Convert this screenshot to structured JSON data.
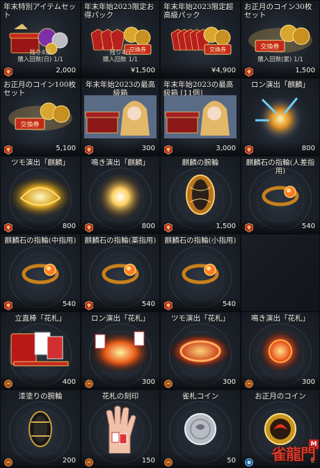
{
  "items": [
    {
      "title": "年末特別アイテムセット",
      "price": "2,000",
      "currency": "gem",
      "notes": [
        "残り4日",
        "購入回数(日) 1/1"
      ],
      "art": "set"
    },
    {
      "title": "年末年始2023限定お得パック",
      "price": "¥1,500",
      "currency": "yen",
      "notes": [
        "残り4日",
        "購入回数 1/1"
      ],
      "art": "pack"
    },
    {
      "title": "年末年始2023限定超高級パック",
      "price": "¥4,900",
      "currency": "yen",
      "notes": [],
      "art": "pack-big"
    },
    {
      "title": "お正月のコイン30枚セット",
      "price": "1,500",
      "currency": "gem",
      "notes": [
        "購入回数(累) 1/1"
      ],
      "art": "coins"
    },
    {
      "title": "お正月のコイン100枚セット",
      "price": "5,100",
      "currency": "gem",
      "notes": [],
      "art": "coins-big"
    },
    {
      "title": "年末年始2023の最高級箱",
      "price": "300",
      "currency": "gem",
      "notes": [],
      "art": "box",
      "center": true
    },
    {
      "title": "年末年始2023の最高級箱 [11個]",
      "price": "3,000",
      "currency": "gem",
      "notes": [],
      "art": "box11"
    },
    {
      "title": "ロン演出「麒麟」",
      "price": "800",
      "currency": "gem",
      "notes": [],
      "art": "blue-fx",
      "center": true
    },
    {
      "title": "ツモ演出「麒麟」",
      "price": "800",
      "currency": "gem",
      "notes": [],
      "art": "gold-fx",
      "center": true
    },
    {
      "title": "鳴き演出「麒麟」",
      "price": "800",
      "currency": "gem",
      "notes": [],
      "art": "burst",
      "center": true
    },
    {
      "title": "麒麟の腕輪",
      "price": "1,500",
      "currency": "gem",
      "notes": [],
      "art": "bracelet",
      "center": true
    },
    {
      "title": "麒麟石の指輪(人差指用)",
      "price": "540",
      "currency": "gem",
      "notes": [],
      "art": "ring",
      "center": true
    },
    {
      "title": "麒麟石の指輪(中指用)",
      "price": "540",
      "currency": "gem",
      "notes": [],
      "art": "ring",
      "center": true
    },
    {
      "title": "麒麟石の指輪(薬指用)",
      "price": "540",
      "currency": "gem",
      "notes": [],
      "art": "ring",
      "center": true
    },
    {
      "title": "麒麟石の指輪(小指用)",
      "price": "540",
      "currency": "gem",
      "notes": [],
      "art": "ring",
      "center": true
    },
    {
      "empty": true
    },
    {
      "title": "立直棒「花札」",
      "price": "400",
      "currency": "coin",
      "notes": [],
      "art": "cards",
      "center": true
    },
    {
      "title": "ロン演出「花札」",
      "price": "300",
      "currency": "coin",
      "notes": [],
      "art": "fire-cards",
      "center": true
    },
    {
      "title": "ツモ演出「花札」",
      "price": "300",
      "currency": "coin",
      "notes": [],
      "art": "fire-ring",
      "center": true
    },
    {
      "title": "鳴き演出「花札」",
      "price": "300",
      "currency": "coin",
      "notes": [],
      "art": "vortex",
      "center": true
    },
    {
      "title": "漆塗りの腕輪",
      "price": "200",
      "currency": "coin",
      "notes": [],
      "art": "black-band",
      "center": true
    },
    {
      "title": "花札の刻印",
      "price": "150",
      "currency": "coin",
      "notes": [],
      "art": "hand",
      "center": true
    },
    {
      "title": "雀札コイン",
      "price": "50",
      "currency": "coin",
      "notes": [],
      "art": "silver-coin",
      "center": true
    },
    {
      "title": "お正月のコイン",
      "price": "5",
      "currency": "blue",
      "notes": [],
      "art": "newyear-coin",
      "center": true,
      "logo": "雀龍門",
      "logo_badge": "M"
    }
  ],
  "colors": {
    "gem": "#c8332a",
    "coin": "#c96a1e",
    "blue": "#2f8fd8"
  }
}
